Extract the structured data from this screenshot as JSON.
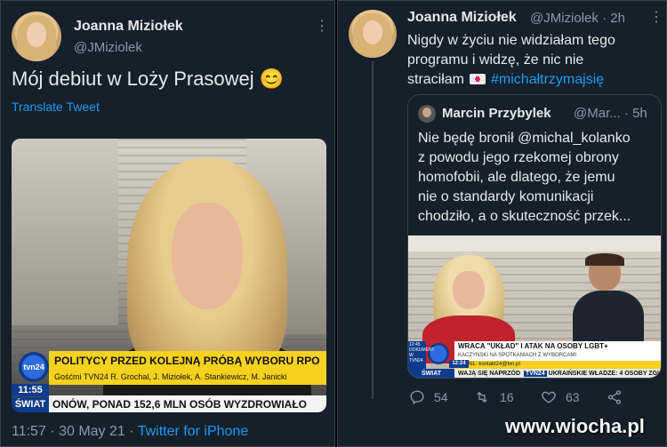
{
  "left_tweet": {
    "author_name": "Joanna Miziołek",
    "author_handle": "@JMiziolek",
    "more_label": "⋮",
    "text": "Mój debiut w Loży Prasowej",
    "emoji": "😊",
    "translate_label": "Translate Tweet",
    "timestamp": "11:57 · 30 May 21 · ",
    "source_link": "Twitter for iPhone",
    "tv": {
      "headline": "POLITYCY PRZED KOLEJNĄ PRÓBĄ WYBORU RPO",
      "guests": "Gośćmi TVN24 R. Grochal, J. Miziołek, A. Stankiewicz, M. Janicki",
      "ticker": "ONÓW, PONAD 152,6 MLN OSÓB WYZDROWIAŁO",
      "clock": "11:55",
      "channel": "ŚWIAT",
      "logo": "tvn24"
    }
  },
  "right_tweet": {
    "author_name": "Joanna Miziołek",
    "author_handle": "@JMiziolek · 2h",
    "more_label": "⋮",
    "text_line1": "Nigdy w życiu nie widziałam tego",
    "text_line2": "programu i widzę, że nic nie",
    "text_line3": "straciłam",
    "hashtag": "#michałtrzymajsię",
    "quote": {
      "author_name": "Marcin Przybylek",
      "author_handle": "@Mar... · 5h",
      "line1": "Nie będę bronił @michal_kolanko",
      "line2": "z powodu jego rzekomej obrony",
      "line3": "homofobii, ale dlatego, że jemu",
      "line4": "nie o standardy komunikacji",
      "line5": "chodziło, a o skuteczność przek...",
      "tv": {
        "headline": "WRACA \"UKŁAD\" I ATAK NA OSOBY LGBT+",
        "sub": "KACZYŃSKI NA SPOTKANIACH Z WYBORCAMI",
        "email": "E-MAIL: kontakt24@tvn.pl",
        "ticker": "WAJĄ SIĘ NAPRZÓD",
        "ticker2": "UKRAIŃSKIE WŁADZE: 4 OSOBY ZGI",
        "clock": "12:24",
        "time_small": "12:45",
        "side_label": "DOKUMENT W TVN24",
        "channel": "ŚWIAT",
        "channel2": "TVN24"
      }
    },
    "actions": {
      "reply_count": "54",
      "retweet_count": "16",
      "like_count": "63"
    }
  },
  "watermark": "www.wiocha.pl"
}
